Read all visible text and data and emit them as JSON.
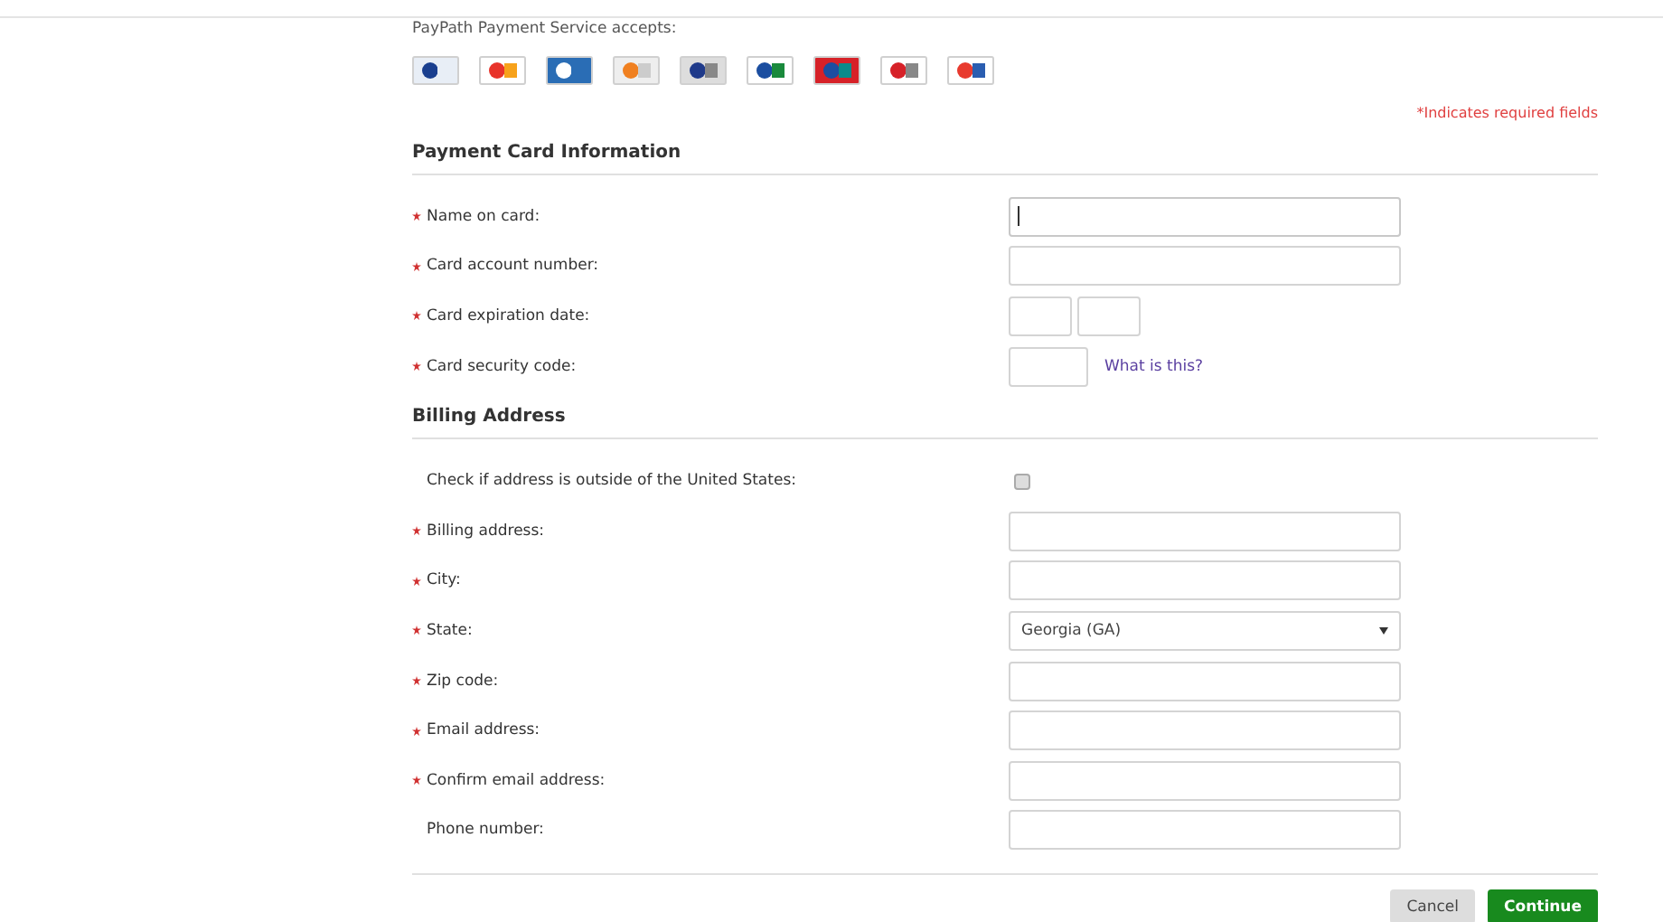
{
  "accepts_label": "PayPath Payment Service accepts:",
  "required_note": "*Indicates required fields",
  "sections": [
    {
      "title": "Payment Card Information",
      "fields": [
        {
          "kind": "text",
          "label": "Name on card:",
          "required": true,
          "focused": true
        },
        {
          "kind": "text",
          "label": "Card account number:",
          "required": true,
          "focused": false
        },
        {
          "kind": "expiry",
          "label": "Card expiration date:",
          "required": true
        },
        {
          "kind": "cvv",
          "label": "Card security code:",
          "required": true,
          "link": "What is this?"
        }
      ]
    },
    {
      "title": "Billing Address",
      "fields": [
        {
          "kind": "checkbox",
          "label": "Check if address is outside of the United States:",
          "required": false,
          "checked": false
        },
        {
          "kind": "text",
          "label": "Billing address:",
          "required": true,
          "focused": false
        },
        {
          "kind": "text",
          "label": "City:",
          "required": true,
          "focused": false
        },
        {
          "kind": "select",
          "label": "State:",
          "required": true,
          "value": "Georgia (GA)"
        },
        {
          "kind": "text",
          "label": "Zip code:",
          "required": true,
          "focused": false
        },
        {
          "kind": "text",
          "label": "Email address:",
          "required": true,
          "focused": false
        },
        {
          "kind": "text",
          "label": "Confirm email address:",
          "required": true,
          "focused": false
        },
        {
          "kind": "text",
          "label": "Phone number:",
          "required": false,
          "focused": false
        }
      ]
    }
  ],
  "buttons": [
    {
      "label": "Cancel",
      "kind": "secondary"
    },
    {
      "label": "Continue",
      "kind": "primary"
    }
  ]
}
